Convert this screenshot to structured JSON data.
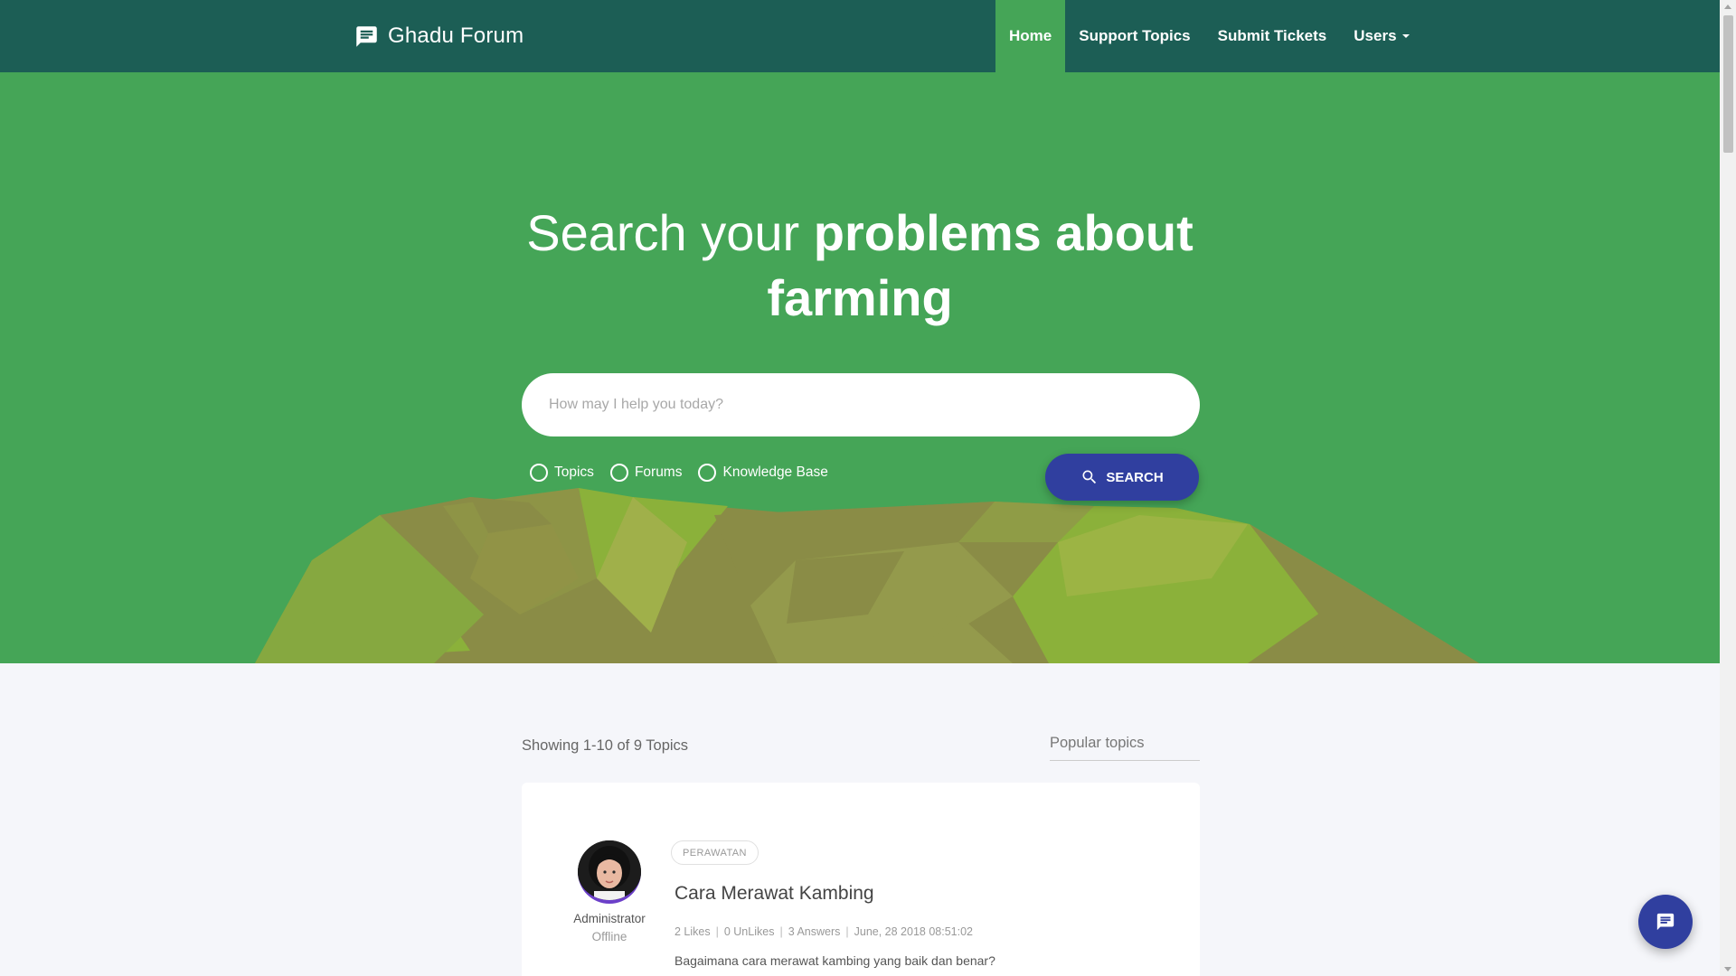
{
  "navbar": {
    "brand_icon": "chat-bubble-icon",
    "brand_name": "Ghadu Forum",
    "items": [
      {
        "label": "Home",
        "active": true
      },
      {
        "label": "Support Topics",
        "active": false
      },
      {
        "label": "Submit Tickets",
        "active": false
      },
      {
        "label": "Users",
        "active": false,
        "dropdown": true
      }
    ]
  },
  "hero": {
    "title_light": "Search your ",
    "title_bold_1": "problems about",
    "title_bold_2": "farming",
    "search_placeholder": "How may I help you today?",
    "search_value": "",
    "radio_options": [
      {
        "label": "Topics",
        "checked": false
      },
      {
        "label": "Forums",
        "checked": false
      },
      {
        "label": "Knowledge Base",
        "checked": false
      }
    ],
    "search_button": "SEARCH",
    "search_button_icon": "search-icon"
  },
  "content": {
    "showing_text": "Showing 1-10 of 9 Topics",
    "popular_label": "Popular topics",
    "topics": [
      {
        "category": "PERAWATAN",
        "title": "Cara Merawat Kambing",
        "author": "Administrator",
        "status": "Offline",
        "likes": "2 Likes",
        "unlikes": "0 UnLikes",
        "answers": "3 Answers",
        "date": "June, 28 2018 08:51:02",
        "excerpt": "Bagaimana cara merawat kambing yang baik dan benar?"
      }
    ]
  },
  "chat_fab_icon": "chat-icon",
  "colors": {
    "navbar": "#1c5e55",
    "hero": "#45a557",
    "active_nav": "#45a557",
    "accent": "#303f9f",
    "mountain_light": "#8bb13a",
    "mountain_dark": "#8a8c46"
  }
}
